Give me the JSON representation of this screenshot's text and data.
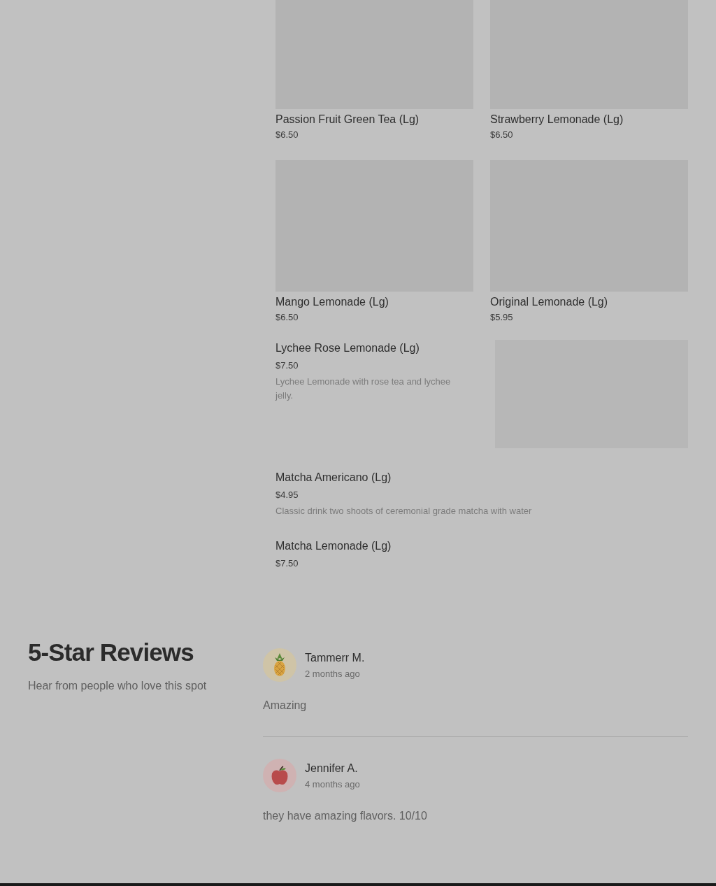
{
  "menu_items": [
    {
      "kind": "tile",
      "name": "Passion Fruit Green Tea (Lg)",
      "price": "$6.50"
    },
    {
      "kind": "tile",
      "name": "Strawberry Lemonade (Lg)",
      "price": "$6.50"
    },
    {
      "kind": "tile",
      "name": "Mango Lemonade (Lg)",
      "price": "$6.50"
    },
    {
      "kind": "tile",
      "name": "Original Lemonade (Lg)",
      "price": "$5.95"
    },
    {
      "kind": "row",
      "name": "Lychee Rose Lemonade (Lg)",
      "price": "$7.50",
      "description": "Lychee Lemonade with rose tea and lychee jelly.",
      "image": true
    },
    {
      "kind": "row",
      "name": "Matcha Americano (Lg)",
      "price": "$4.95",
      "description": "Classic drink two shoots of ceremonial grade matcha with water",
      "image": false
    },
    {
      "kind": "row",
      "name": "Matcha Lemonade (Lg)",
      "price": "$7.50",
      "image": false
    }
  ],
  "reviews_section": {
    "title": "5-Star Reviews",
    "subtitle": "Hear from people who love this spot",
    "reviews": [
      {
        "kind": "pineapple",
        "author": "Tammerr M.",
        "time": "2 months ago",
        "text": "Amazing"
      },
      {
        "kind": "apple",
        "author": "Jennifer A.",
        "time": "4 months ago",
        "text": "they have amazing flavors. 10/10"
      }
    ]
  }
}
